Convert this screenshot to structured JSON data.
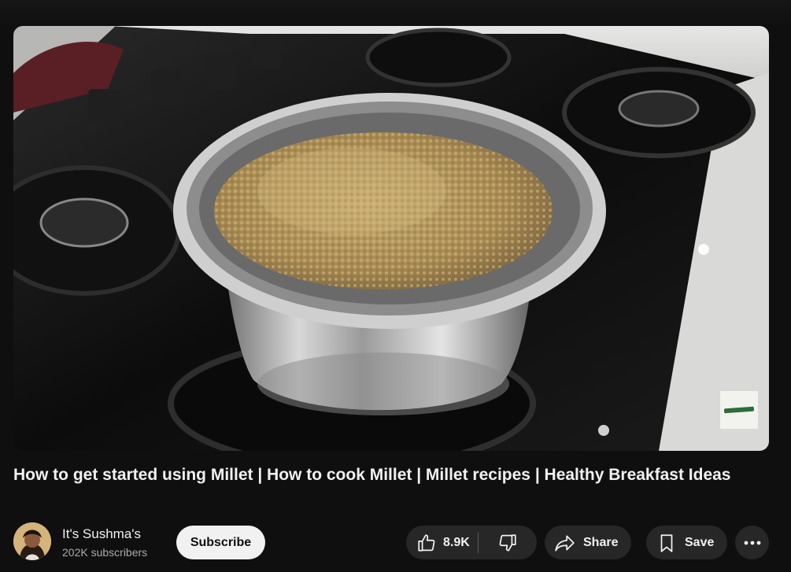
{
  "video": {
    "title": "How to get started using Millet | How to cook Millet | Millet recipes | Healthy Breakfast Ideas"
  },
  "channel": {
    "name": "It's Sushma's",
    "subscribers": "202K subscribers",
    "subscribe_label": "Subscribe"
  },
  "actions": {
    "like_count": "8.9K",
    "share_label": "Share",
    "save_label": "Save"
  },
  "icons": {
    "like": "thumbs-up-icon",
    "dislike": "thumbs-down-icon",
    "share": "share-arrow-icon",
    "save": "bookmark-icon",
    "more": "more-dots-icon"
  },
  "colors": {
    "background": "#0f0f0f",
    "pill": "#272727",
    "subscribe_bg": "#f1f1f1",
    "text_secondary": "#aaaaaa"
  }
}
